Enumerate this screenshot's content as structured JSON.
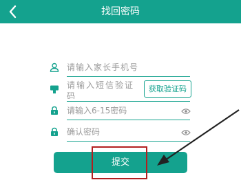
{
  "header": {
    "title": "找回密码",
    "back_icon": "chevron-left-icon"
  },
  "form": {
    "phone": {
      "placeholder": "请输入家长手机号",
      "icon": "user-icon"
    },
    "code": {
      "placeholder": "请输入短信验证码",
      "icon": "message-icon",
      "get_code_label": "获取验证码"
    },
    "password": {
      "placeholder": "请输入6-15密码",
      "icon": "lock-icon",
      "toggle_icon": "eye-icon"
    },
    "confirm": {
      "placeholder": "确认密码",
      "icon": "lock-icon",
      "toggle_icon": "eye-icon"
    }
  },
  "submit_label": "提交",
  "colors": {
    "accent": "#14a28e",
    "highlight": "#b21e1e",
    "placeholder": "#9a9a9a"
  }
}
